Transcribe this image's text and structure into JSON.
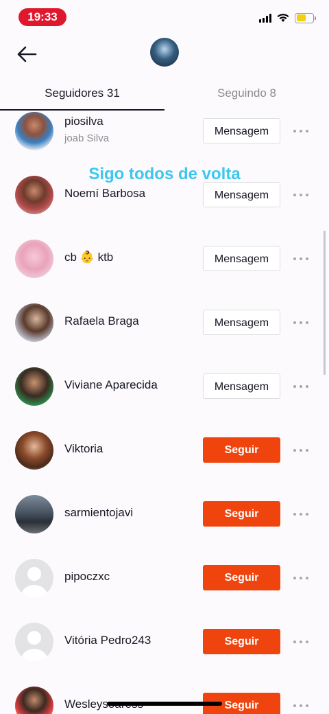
{
  "status_bar": {
    "time": "19:33"
  },
  "tabs": [
    {
      "label": "Seguidores 31",
      "active": true
    },
    {
      "label": "Seguindo 8",
      "active": false
    }
  ],
  "overlay_caption": "Sigo todos de volta",
  "followers": [
    {
      "name": "piosilva",
      "subname": "joab Silva",
      "button": "Mensagem",
      "following": true
    },
    {
      "name": "Noemí Barbosa",
      "subname": "",
      "button": "Mensagem",
      "following": true
    },
    {
      "name": "cb 👶 ktb",
      "subname": "",
      "button": "Mensagem",
      "following": true
    },
    {
      "name": "Rafaela Braga",
      "subname": "",
      "button": "Mensagem",
      "following": true
    },
    {
      "name": "Viviane Aparecida",
      "subname": "",
      "button": "Mensagem",
      "following": true
    },
    {
      "name": "Viktoria",
      "subname": "",
      "button": "Seguir",
      "following": false
    },
    {
      "name": "sarmientojavi",
      "subname": "",
      "button": "Seguir",
      "following": false
    },
    {
      "name": "pipoczxc",
      "subname": "",
      "button": "Seguir",
      "following": false
    },
    {
      "name": "Vitória Pedro243",
      "subname": "",
      "button": "Seguir",
      "following": false
    },
    {
      "name": "Wesleysoaress",
      "subname": "",
      "button": "Seguir",
      "following": false
    }
  ],
  "colors": {
    "follow_button": "#f0440f",
    "caption": "#3cc8ee",
    "time_pill": "#e0182e",
    "battery": "#f2d10c"
  },
  "icons": {
    "back": "arrow-left-icon",
    "more": "more-horizontal-icon",
    "wifi": "wifi-icon",
    "signal": "cellular-signal-icon",
    "battery": "battery-icon"
  }
}
